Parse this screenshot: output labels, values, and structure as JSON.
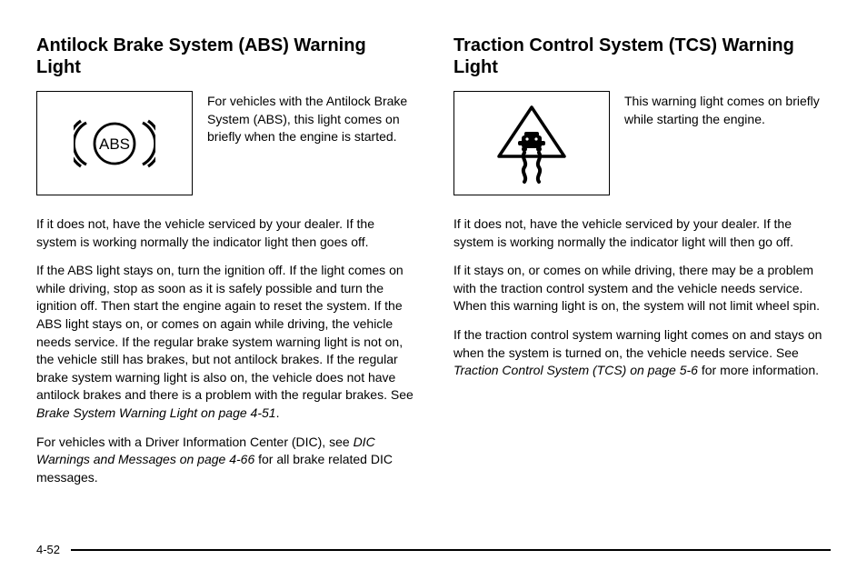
{
  "left": {
    "heading": "Antilock Brake System (ABS) Warning Light",
    "absLabel": "ABS",
    "intro": "For vehicles with the Antilock Brake System (ABS), this light comes on briefly when the engine is started.",
    "p1": "If it does not, have the vehicle serviced by your dealer. If the system is working normally the indicator light then goes off.",
    "p2a": "If the ABS light stays on, turn the ignition off. If the light comes on while driving, stop as soon as it is safely possible and turn the ignition off. Then start the engine again to reset the system. If the ABS light stays on, or comes on again while driving, the vehicle needs service. If the regular brake system warning light is not on, the vehicle still has brakes, but not antilock brakes. If the regular brake system warning light is also on, the vehicle does not have antilock brakes and there is a problem with the regular brakes. See ",
    "p2ref": "Brake System Warning Light on page 4‑51",
    "p2b": ".",
    "p3a": "For vehicles with a Driver Information Center (DIC), see ",
    "p3ref": "DIC Warnings and Messages on page 4‑66",
    "p3b": " for all brake related DIC messages."
  },
  "right": {
    "heading": "Traction Control System (TCS) Warning Light",
    "intro": "This warning light comes on briefly while starting the engine.",
    "p1": "If it does not, have the vehicle serviced by your dealer. If the system is working normally the indicator light will then go off.",
    "p2": "If it stays on, or comes on while driving, there may be a problem with the traction control system and the vehicle needs service. When this warning light is on, the system will not limit wheel spin.",
    "p3a": "If the traction control system warning light comes on and stays on when the system is turned on, the vehicle needs service. See ",
    "p3ref": "Traction Control System (TCS) on page 5‑6",
    "p3b": " for more information."
  },
  "pageNumber": "4-52"
}
